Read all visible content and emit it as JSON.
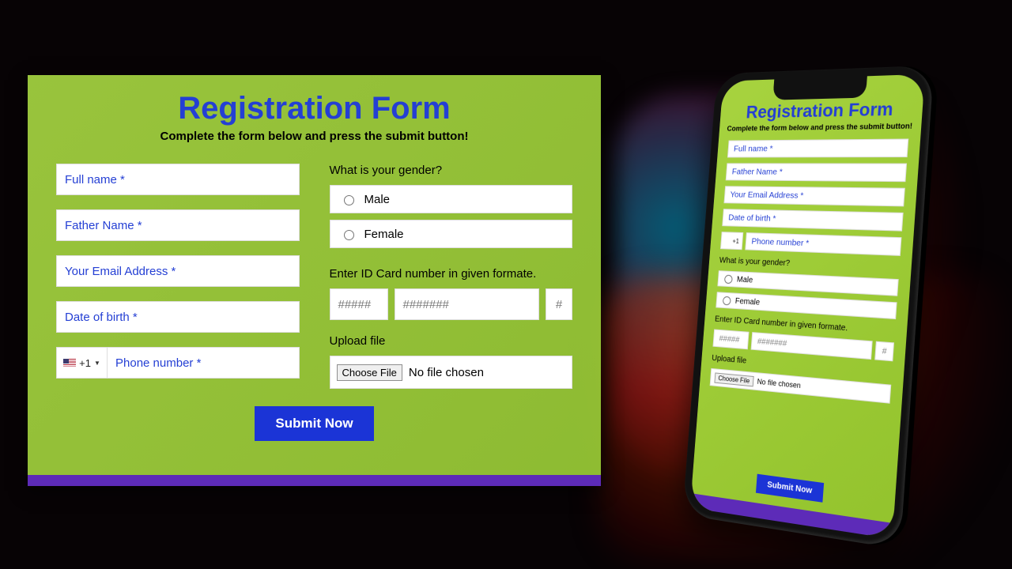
{
  "title": "Registration Form",
  "subtitle": "Complete the form below and press the submit button!",
  "fields": {
    "full_name": "Full name *",
    "father_name": "Father Name *",
    "email": "Your Email Address *",
    "dob": "Date of birth *",
    "phone_cc": "+1",
    "phone": "Phone number *"
  },
  "gender": {
    "label": "What is your gender?",
    "options": [
      "Male",
      "Female"
    ]
  },
  "id_card": {
    "label": "Enter ID Card number in given formate.",
    "p1": "#####",
    "p2": "#######",
    "p3": "#"
  },
  "upload": {
    "label": "Upload file",
    "button": "Choose File",
    "status": "No file chosen"
  },
  "submit": "Submit Now"
}
